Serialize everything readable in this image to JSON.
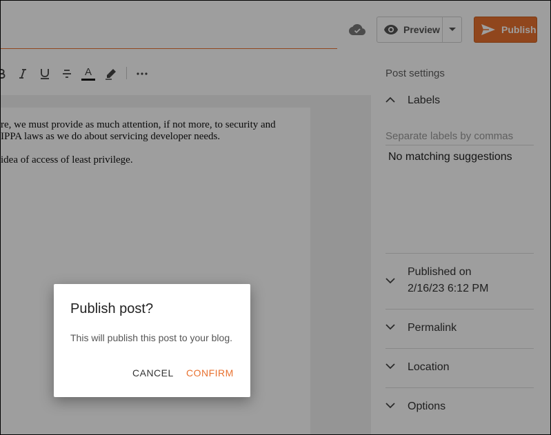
{
  "header": {
    "preview_label": "Preview",
    "publish_label": "Publish"
  },
  "toolbar": {
    "icons": [
      "bold-icon",
      "italic-icon",
      "underline-icon",
      "strikethrough-icon",
      "text-color-icon",
      "highlight-icon",
      "more-icon"
    ],
    "text_color_glyph": "A",
    "italic_glyph": "I",
    "underline_glyph": "U",
    "more_glyph": "•••"
  },
  "editor": {
    "paragraphs": [
      "re, we must provide as much attention, if not more, to security and",
      "IPPA laws as we do about servicing developer needs.",
      "idea of access of least privilege."
    ]
  },
  "sidebar": {
    "title": "Post settings",
    "labels": {
      "label": "Labels",
      "placeholder": "Separate labels by commas",
      "no_match": "No matching suggestions"
    },
    "published": {
      "label": "Published on",
      "value": "2/16/23 6:12 PM"
    },
    "permalink": "Permalink",
    "location": "Location",
    "options": "Options"
  },
  "dialog": {
    "title": "Publish post?",
    "body": "This will publish this post to your blog.",
    "cancel_label": "CANCEL",
    "confirm_label": "CONFIRM"
  },
  "colors": {
    "accent": "#e8712f",
    "overlay": "rgba(0,0,0,0.38)"
  }
}
